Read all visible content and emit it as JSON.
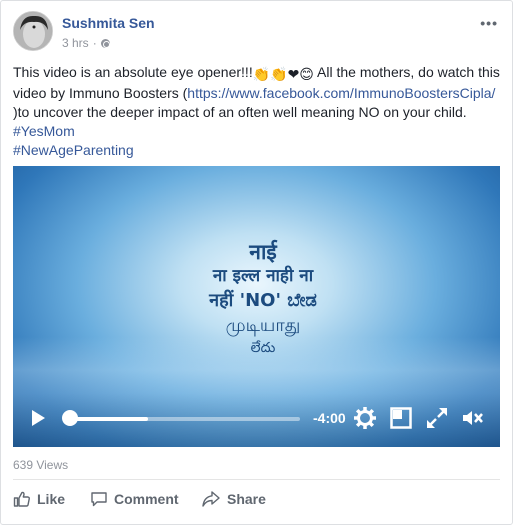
{
  "post": {
    "author": "Sushmita Sen",
    "time": "3 hrs",
    "separator": "·",
    "more": "•••",
    "text_before_link": "This video is an absolute eye opener!!!",
    "text_after_emoji": " All the mothers, do watch this video by Immuno Boosters (",
    "link": "https://www.facebook.com/ImmunoBoostersCipla/",
    "text_after_link": " )to uncover the deeper impact of an often well meaning NO on your child. ",
    "hashtag1": "#YesMom",
    "hashtag2": "#NewAgeParenting",
    "emojis": "👏👏❤😊"
  },
  "video": {
    "words": [
      "नाई",
      "ना इल्ल नाही ना",
      "नहीं 'NO' ಬೇಡ",
      "முடியாது",
      "లేదు"
    ],
    "time_remaining": "-4:00",
    "progress_percent": 34
  },
  "stats": {
    "views": "639 Views"
  },
  "actions": {
    "like": "Like",
    "comment": "Comment",
    "share": "Share"
  },
  "colors": {
    "link": "#365899",
    "meta": "#90949c",
    "video_text": "#1c4b7f"
  }
}
